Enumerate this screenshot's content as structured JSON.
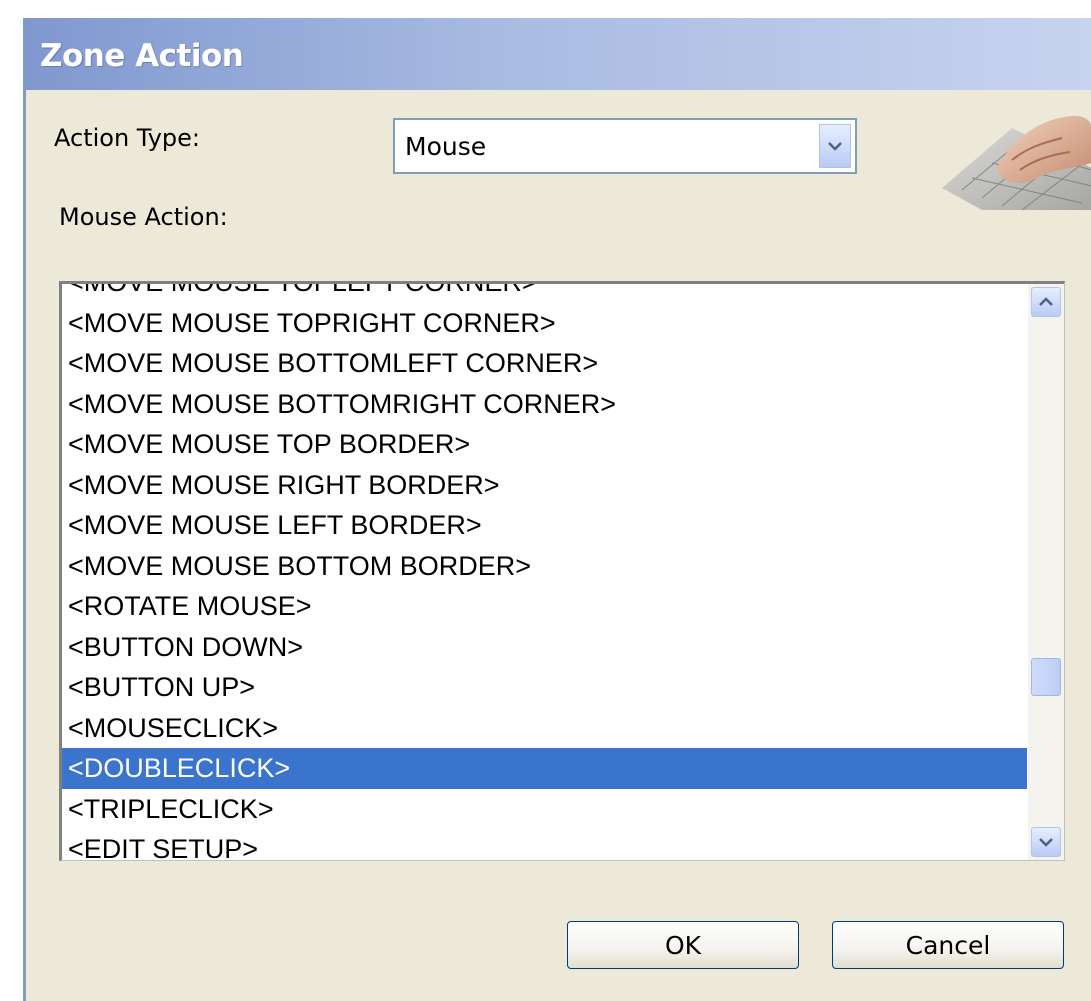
{
  "window": {
    "title": "Zone Action"
  },
  "form": {
    "action_type_label": "Action Type:",
    "action_type_value": "Mouse",
    "mouse_action_label": "Mouse Action:"
  },
  "list": {
    "items": [
      "<MOVE MOUSE TOPLEFT CORNER>",
      "<MOVE MOUSE TOPRIGHT CORNER>",
      "<MOVE MOUSE BOTTOMLEFT CORNER>",
      "<MOVE MOUSE BOTTOMRIGHT CORNER>",
      "<MOVE MOUSE TOP BORDER>",
      "<MOVE MOUSE RIGHT BORDER>",
      "<MOVE MOUSE LEFT BORDER>",
      "<MOVE MOUSE BOTTOM BORDER>",
      "<ROTATE MOUSE>",
      "<BUTTON DOWN>",
      "<BUTTON UP>",
      "<MOUSECLICK>",
      "<DOUBLECLICK>",
      "<TRIPLECLICK>",
      "<EDIT SETUP>"
    ],
    "selected_item": "<DOUBLECLICK>",
    "selection_color": "#3a74cd"
  },
  "buttons": {
    "ok_label": "OK",
    "cancel_label": "Cancel"
  },
  "icons": {
    "combo_arrow": "chevron-down-icon",
    "scroll_up": "chevron-up-icon",
    "scroll_down": "chevron-down-icon",
    "header_image": "hand-on-keyboard-icon"
  },
  "colors": {
    "dialog_background": "#ece9d8",
    "title_text": "#ffffff",
    "border_blue": "#7f9db9"
  }
}
